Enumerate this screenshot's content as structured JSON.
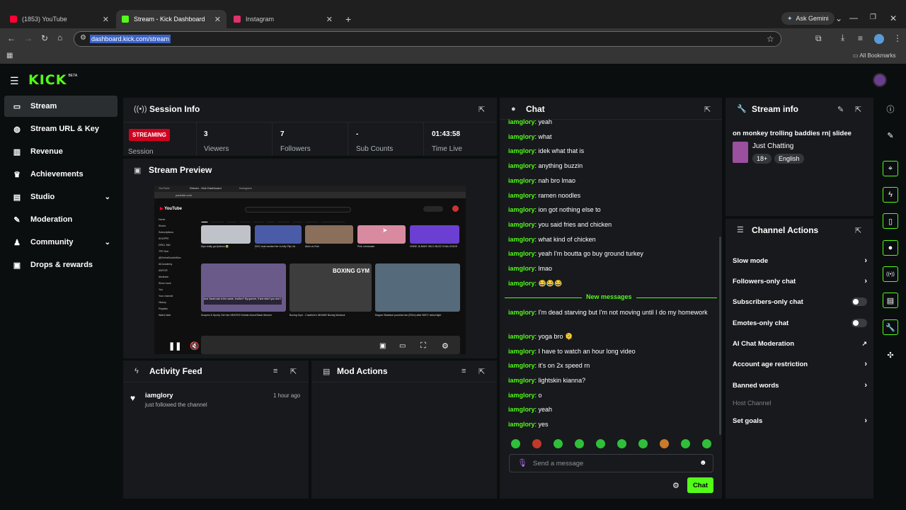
{
  "browser": {
    "tabs": [
      {
        "title": "(1853) YouTube",
        "color": "#ff0033"
      },
      {
        "title": "Stream - Kick Dashboard",
        "color": "#53fc18"
      },
      {
        "title": "Instagram",
        "color": "#e1306c"
      }
    ],
    "url": "dashboard.kick.com/stream",
    "ask_gemini": "Ask Gemini",
    "all_bookmarks": "All Bookmarks"
  },
  "app": {
    "logo": "KICK",
    "logo_badge": "BETA",
    "accent": "#53fc18"
  },
  "sidebar": {
    "items": [
      {
        "label": "Stream",
        "icon": "tv-icon"
      },
      {
        "label": "Stream URL & Key",
        "icon": "globe-icon"
      },
      {
        "label": "Revenue",
        "icon": "chart-icon"
      },
      {
        "label": "Achievements",
        "icon": "trophy-icon"
      },
      {
        "label": "Studio",
        "icon": "studio-icon"
      },
      {
        "label": "Moderation",
        "icon": "wrench-icon"
      },
      {
        "label": "Community",
        "icon": "people-icon"
      },
      {
        "label": "Drops & rewards",
        "icon": "gift-icon"
      }
    ]
  },
  "session": {
    "title": "Session Info",
    "status": "STREAMING",
    "status_label": "Session",
    "stats": [
      {
        "value": "3",
        "label": "Viewers"
      },
      {
        "value": "7",
        "label": "Followers"
      },
      {
        "value": "-",
        "label": "Sub Counts"
      },
      {
        "value": "01:43:58",
        "label": "Time Live"
      }
    ]
  },
  "preview": {
    "title": "Stream Preview",
    "embedded_tabs": [
      "YouTube",
      "Stream - Kick Dashboard",
      "Instagram"
    ],
    "embedded_url": "youtube.com",
    "embedded_sidebar": [
      "Home",
      "Shorts",
      "Subscriptions",
      "SHOPPE",
      "DRILL Mid",
      "TFR Hub",
      "@OnlineDoubleMon",
      "All Academy",
      "AWTCR",
      "Abraham",
      "Show more",
      "You",
      "Your channel",
      "History",
      "Playlists",
      "Watch later"
    ],
    "embedded_chips": [
      "All",
      "Podcasts",
      "Music",
      "Mixes",
      "Boxing",
      "Live",
      "Gaming",
      "News",
      "Comedy",
      "Recently uploaded"
    ],
    "embedded_video_titles": [
      "Mya really got jealous 😭",
      "DDG chat wanted her to fully Flip Ltd #rapbattle",
      "Akim vs Rob",
      "Pink Lemonade",
      "HOBE JA BABY WILD BUZZ CHALLENGE",
      "Suspect & Sporty Get Into HEATED Debate About Black Women",
      "Boxing Gym - Crawford's INSANE Boxing Workout",
      "Rapper Blueface punches fan (RGm) after BKFC debut fight"
    ],
    "embedded_overlay": "BOXING GYM",
    "embedded_caption": "And Sarah ask is the same, brother? My gunner, if she didn't you don't"
  },
  "activity": {
    "title": "Activity Feed",
    "items": [
      {
        "user": "iamglory",
        "action": "just followed the channel",
        "time": "1 hour ago"
      }
    ]
  },
  "mod_actions": {
    "title": "Mod Actions"
  },
  "chat": {
    "title": "Chat",
    "username": "iamglory",
    "messages": [
      "yeah",
      "what",
      "idek what that is",
      "anything buzzin",
      "nah bro lmao",
      "ramen noodles",
      "ion got nothing else to",
      "you said fries and chicken",
      "what kind of chicken",
      "yeah I'm boutta go buy ground turkey",
      "lmao",
      "😂😂😂"
    ],
    "divider": "New messages",
    "new_messages": [
      "I'm dead starving but I'm not moving until I do my homework",
      "yoga bro 🫠",
      "I have to watch an hour long video",
      "it's on 2x speed rn",
      "lightskin kianna?",
      "o",
      "yeah",
      "yes"
    ],
    "input_placeholder": "Send a message",
    "send_label": "Chat"
  },
  "stream_info": {
    "title": "Stream info",
    "stream_title": "on monkey trolling baddies rn| slidee",
    "category": "Just Chatting",
    "tags": [
      "18+",
      "English"
    ]
  },
  "channel_actions": {
    "title": "Channel Actions",
    "rows": [
      {
        "label": "Slow mode",
        "control": "arrow"
      },
      {
        "label": "Followers-only chat",
        "control": "arrow"
      },
      {
        "label": "Subscribers-only chat",
        "control": "toggle",
        "on": false
      },
      {
        "label": "Emotes-only chat",
        "control": "toggle",
        "on": false
      },
      {
        "label": "AI Chat Moderation",
        "control": "external"
      },
      {
        "label": "Account age restriction",
        "control": "arrow"
      },
      {
        "label": "Banned words",
        "control": "arrow"
      }
    ],
    "host_channel": "Host Channel",
    "set_goals": "Set goals"
  },
  "right_rail": [
    "info-icon",
    "pencil-icon",
    "target-icon",
    "bolt-icon",
    "note-icon",
    "chat-bubble-icon",
    "broadcast-icon",
    "clipboard-icon",
    "wrench-icon",
    "puzzle-icon"
  ]
}
